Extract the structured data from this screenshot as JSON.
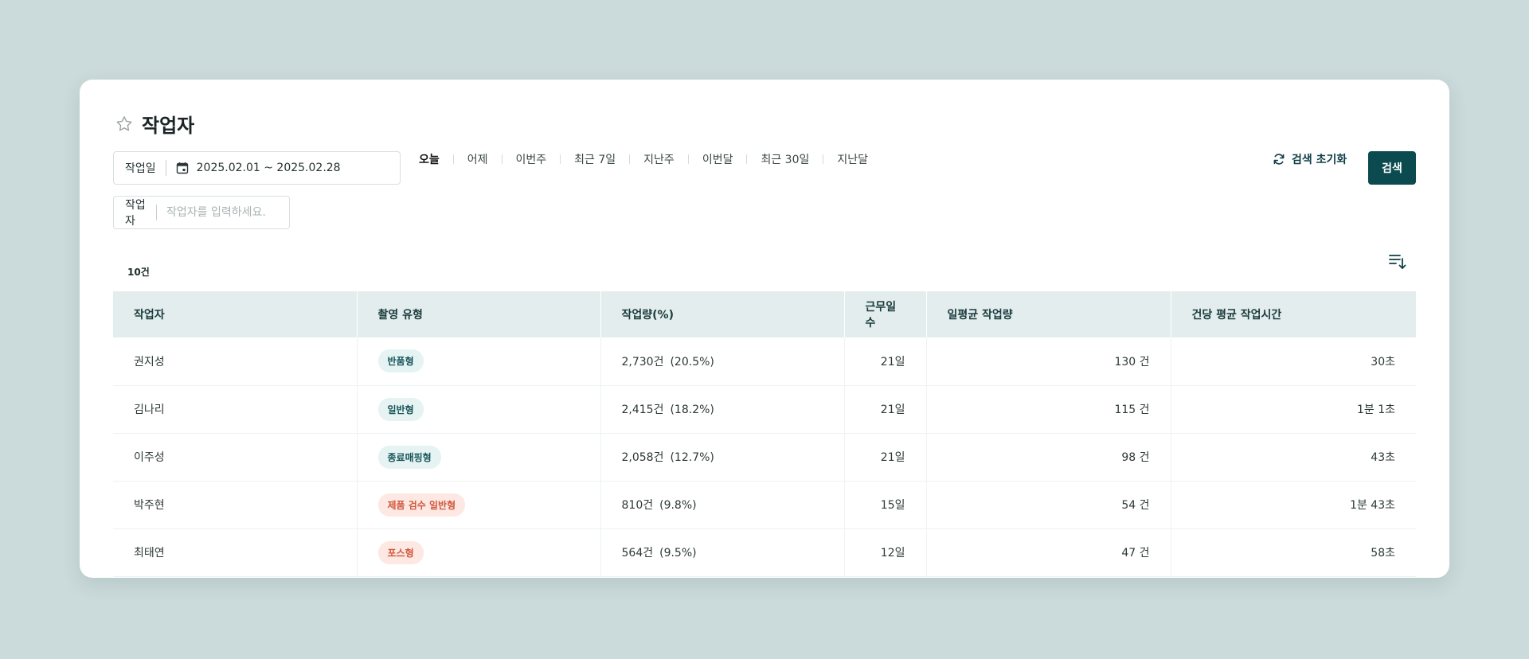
{
  "page": {
    "title": "작업자"
  },
  "filters": {
    "date_label": "작업일",
    "date_range": "2025.02.01 ~ 2025.02.28",
    "worker_label": "작업자",
    "worker_placeholder": "작업자를 입력하세요.",
    "worker_value": ""
  },
  "quick_ranges": [
    {
      "label": "오늘",
      "active": true
    },
    {
      "label": "어제"
    },
    {
      "label": "이번주"
    },
    {
      "label": "최근 7일"
    },
    {
      "label": "지난주"
    },
    {
      "label": "이번달"
    },
    {
      "label": "최근 30일"
    },
    {
      "label": "지난달"
    }
  ],
  "actions": {
    "reset_label": "검색 초기화",
    "search_label": "검색"
  },
  "result": {
    "count_label": "10건"
  },
  "table": {
    "headers": [
      "작업자",
      "촬영 유형",
      "작업량(%)",
      "근무일수",
      "일평균 작업량",
      "건당 평균 작업시간"
    ],
    "rows": [
      {
        "name": "권지성",
        "type": "반품형",
        "type_tone": "teal",
        "amount": "2,730건",
        "pct": "(20.5%)",
        "days": "21일",
        "avg": "130 건",
        "time": "30초"
      },
      {
        "name": "김나리",
        "type": "일반형",
        "type_tone": "teal",
        "amount": "2,415건",
        "pct": "(18.2%)",
        "days": "21일",
        "avg": "115 건",
        "time": "1분 1초"
      },
      {
        "name": "이주성",
        "type": "종료매핑형",
        "type_tone": "teal",
        "amount": "2,058건",
        "pct": "(12.7%)",
        "days": "21일",
        "avg": "98 건",
        "time": "43초"
      },
      {
        "name": "박주현",
        "type": "제품 검수 일반형",
        "type_tone": "orange",
        "amount": "810건",
        "pct": "(9.8%)",
        "days": "15일",
        "avg": "54 건",
        "time": "1분 43초"
      },
      {
        "name": "최태연",
        "type": "포스형",
        "type_tone": "orange",
        "amount": "564건",
        "pct": "(9.5%)",
        "days": "12일",
        "avg": "47 건",
        "time": "58초"
      }
    ]
  },
  "colors": {
    "accent": "#0b4a4f",
    "header_bg": "#e3eded",
    "badge_teal_bg": "#e5f3f2",
    "badge_orange_bg": "#fde8e3"
  },
  "icons": {
    "title": "star-icon",
    "date": "calendar-icon",
    "reset": "refresh-icon",
    "sort": "sort-icon"
  }
}
